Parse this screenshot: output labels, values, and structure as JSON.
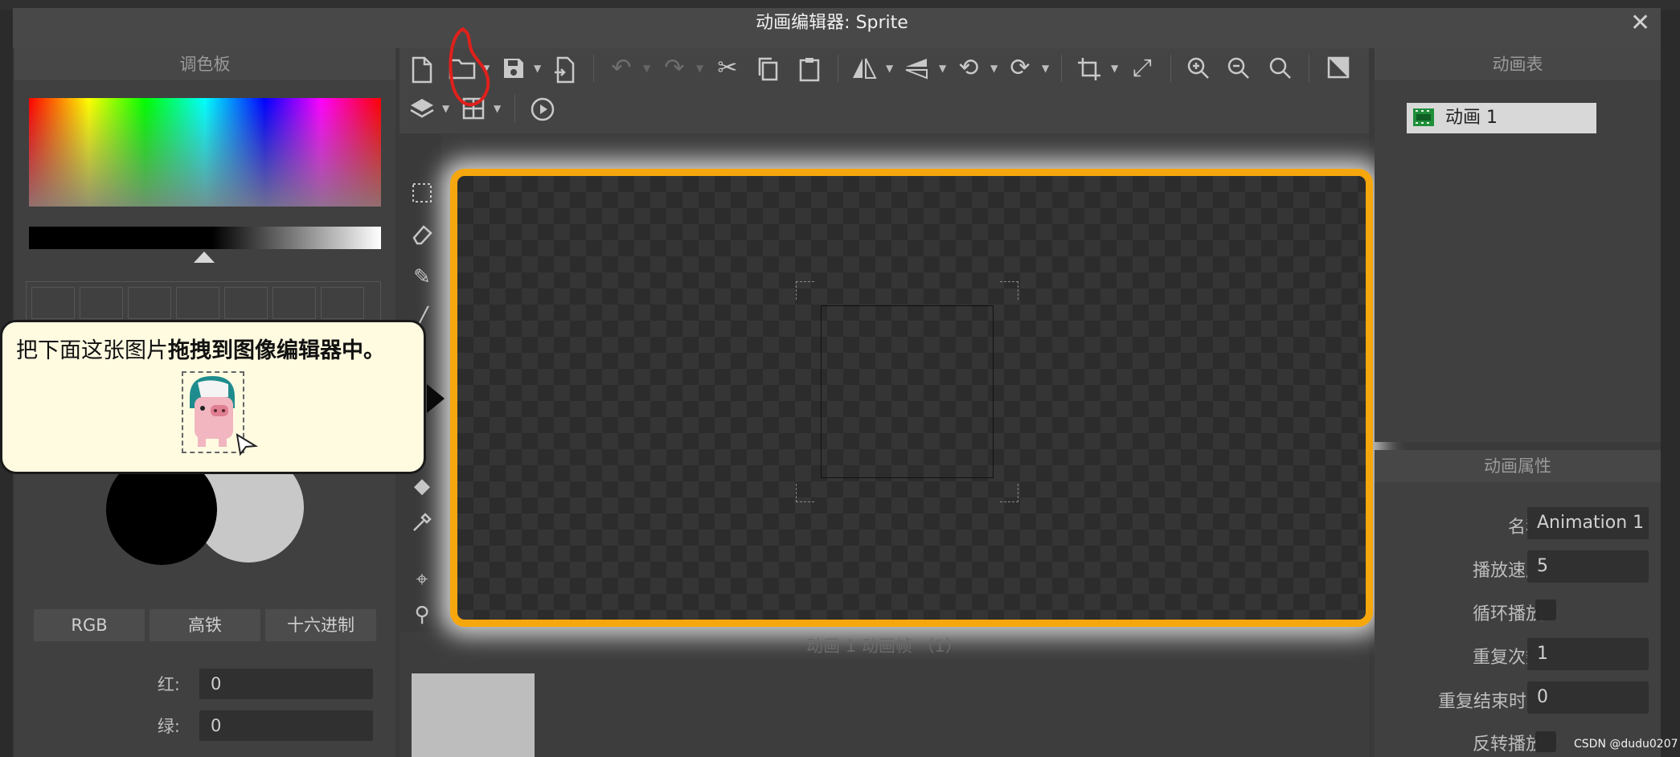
{
  "window": {
    "title": "动画编辑器:  Sprite"
  },
  "palette": {
    "header": "调色板",
    "modes": [
      "RGB",
      "高铁",
      "十六进制"
    ],
    "channels": [
      {
        "label": "红:",
        "value": "0"
      },
      {
        "label": "绿:",
        "value": "0"
      }
    ]
  },
  "tooltip": {
    "text_normal": "把下面这张图片",
    "text_bold": "拖拽到图像编辑器中。"
  },
  "frames": {
    "label": "动画 1 动画帧 （1）"
  },
  "animation_list": {
    "header": "动画表",
    "items": [
      "动画 1"
    ]
  },
  "animation_props": {
    "header": "动画属性",
    "name_label": "名称",
    "name_value": "Animation 1",
    "speed_label": "播放速度",
    "speed_value": "5",
    "loop_label": "循环播放",
    "repeat_label": "重复次数",
    "repeat_value": "1",
    "repeat_end_label": "重复结束时...",
    "repeat_end_value": "0",
    "reverse_label": "反转播放"
  },
  "watermark": "CSDN @dudu0207",
  "colors": {
    "highlight": "#f6a70d",
    "annotation": "#e0201b",
    "tooltip_bg": "#fffbe1"
  }
}
